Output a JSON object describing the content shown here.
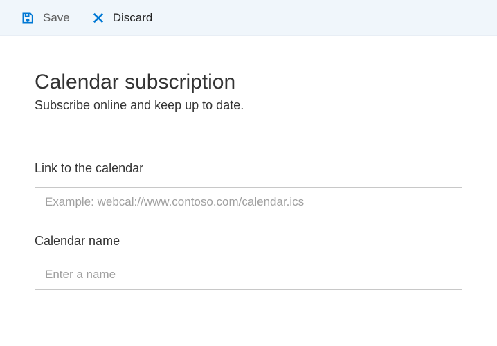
{
  "toolbar": {
    "save_label": "Save",
    "discard_label": "Discard"
  },
  "header": {
    "title": "Calendar subscription",
    "subtitle": "Subscribe online and keep up to date."
  },
  "form": {
    "link": {
      "label": "Link to the calendar",
      "placeholder": "Example: webcal://www.contoso.com/calendar.ics",
      "value": ""
    },
    "name": {
      "label": "Calendar name",
      "placeholder": "Enter a name",
      "value": ""
    }
  },
  "colors": {
    "accent": "#0078d4",
    "toolbar_bg": "#f0f6fb"
  }
}
